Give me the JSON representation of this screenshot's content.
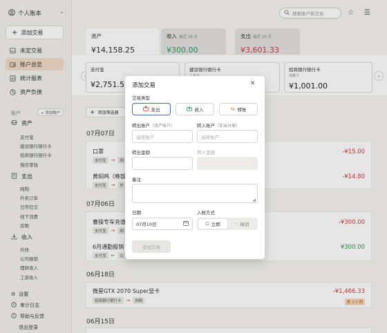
{
  "sidebar": {
    "ledger_name": "个人账本",
    "add_transaction": "添加交易",
    "nav": [
      {
        "label": "未定交易",
        "icon": "inbox-icon"
      },
      {
        "label": "账户总览",
        "icon": "wallet-icon"
      },
      {
        "label": "统计报表",
        "icon": "chart-icon"
      },
      {
        "label": "资产负债",
        "icon": "balance-icon"
      }
    ],
    "accounts_header": "账户",
    "add_account": "+ 添加账户",
    "groups": [
      {
        "label": "资产",
        "items": [
          "支付宝",
          "建设银行银行卡",
          "招商银行银行卡",
          "微信零钱"
        ]
      },
      {
        "label": "支出",
        "items": [
          "网购",
          "外卖订单",
          "日常社交",
          "线下消费",
          "房租"
        ]
      },
      {
        "label": "收入",
        "items": [
          "外快",
          "公司报销",
          "理财收入",
          "工资收入"
        ]
      }
    ],
    "bottom": [
      "设置",
      "审计日志",
      "帮助与反馈",
      "退出登录"
    ]
  },
  "header": {
    "search_placeholder": "搜索账户和交易"
  },
  "summary": {
    "assets": {
      "label": "资产",
      "value": "¥14,158.25"
    },
    "income": {
      "label": "收入",
      "period": "最近 28 天",
      "value": "¥300.00"
    },
    "expense": {
      "label": "支出",
      "period": "最近 28 天",
      "value": "¥3,601.33"
    }
  },
  "accounts": [
    {
      "name": "支付宝",
      "sub": "",
      "value": "¥2,751.52"
    },
    {
      "name": "建设银行银行卡",
      "sub": "工资卡",
      "value": ""
    },
    {
      "name": "招商银行银行卡",
      "sub": "储蓄卡",
      "value": "¥1,001.00"
    }
  ],
  "list": {
    "add_filter": "添加筛选器",
    "groups": [
      {
        "date": "07月07日",
        "rows": [
          {
            "title": "口罩",
            "from": "支付宝",
            "to": "网",
            "amount": "-¥15.00"
          },
          {
            "title": "黄焖鸡（晚饭",
            "from": "支付宝",
            "to": "外",
            "amount": "-¥14.80"
          }
        ]
      },
      {
        "date": "07月06日",
        "rows": [
          {
            "title": "曹操专车充值",
            "from": "支付宝",
            "to": "网",
            "amount": "-¥300.00"
          },
          {
            "title": "6月通勤报销",
            "from": "支付宝",
            "to": "公",
            "amount": "¥300.00"
          }
        ]
      },
      {
        "date": "06月18日",
        "rows": [
          {
            "title": "微星GTX 2070 Super显卡",
            "from": "招商银行银行卡",
            "to": "网购",
            "amount": "-¥1,466.33",
            "installment": "第 2/3 期"
          }
        ]
      },
      {
        "date": "06月15日",
        "rows": []
      }
    ]
  },
  "modal": {
    "title": "添加交易",
    "type_label": "交易类型",
    "types": [
      "支出",
      "收入",
      "转账"
    ],
    "from_label": "转出账户",
    "from_hint": "（资产账户）",
    "to_label": "转入账户",
    "to_hint": "（支出分类）",
    "select_placeholder": "选择账户",
    "out_amount_label": "转出金额",
    "in_amount_label": "转入金额",
    "note_label": "备注",
    "date_label": "日期",
    "date_value": "07月10日",
    "entry_label": "入账方式",
    "entry_options": [
      "立即",
      "摊销"
    ],
    "submit": "添加交易"
  },
  "colors": {
    "accent": "#3e6fb3",
    "income": "#2a9a5a",
    "expense": "#d0383b",
    "active_nav": "#f2dcc6"
  }
}
